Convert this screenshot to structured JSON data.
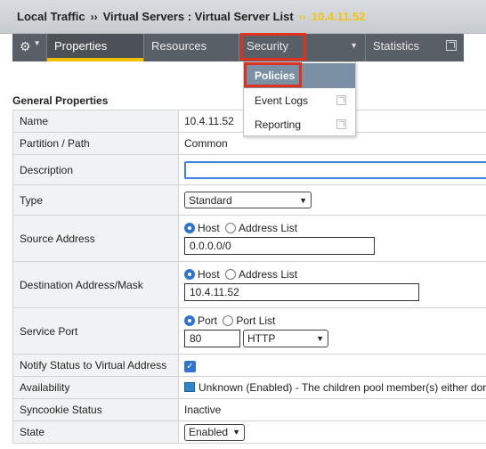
{
  "breadcrumb": {
    "root": "Local Traffic",
    "sep1": "››",
    "section": "Virtual Servers : Virtual Server List",
    "sep2": "››",
    "current": "10.4.11.52"
  },
  "tabs": {
    "gear_icon": "gear-icon",
    "properties": "Properties",
    "resources": "Resources",
    "security": "Security",
    "statistics": "Statistics"
  },
  "security_menu": {
    "items": [
      {
        "label": "Policies"
      },
      {
        "label": "Event Logs"
      },
      {
        "label": "Reporting"
      }
    ]
  },
  "general": {
    "title": "General Properties",
    "name_label": "Name",
    "name_value": "10.4.11.52",
    "partition_label": "Partition / Path",
    "partition_value": "Common",
    "description_label": "Description",
    "description_value": "",
    "type_label": "Type",
    "type_value": "Standard",
    "source_label": "Source Address",
    "source_opt_host": "Host",
    "source_opt_list": "Address List",
    "source_value": "0.0.0.0/0",
    "dest_label": "Destination Address/Mask",
    "dest_opt_host": "Host",
    "dest_opt_list": "Address List",
    "dest_value": "10.4.11.52",
    "port_label": "Service Port",
    "port_opt_port": "Port",
    "port_opt_list": "Port List",
    "port_value": "80",
    "port_protocol": "HTTP",
    "notify_label": "Notify Status to Virtual Address",
    "availability_label": "Availability",
    "availability_value": "Unknown (Enabled) - The children pool member(s) either dor",
    "syncookie_label": "Syncookie Status",
    "syncookie_value": "Inactive",
    "state_label": "State",
    "state_value": "Enabled"
  },
  "colors": {
    "highlight": "#e0301e",
    "tab_accent": "#f2c000",
    "breadcrumb_current": "#f5c40f",
    "menu_active": "#7b8fa5"
  }
}
